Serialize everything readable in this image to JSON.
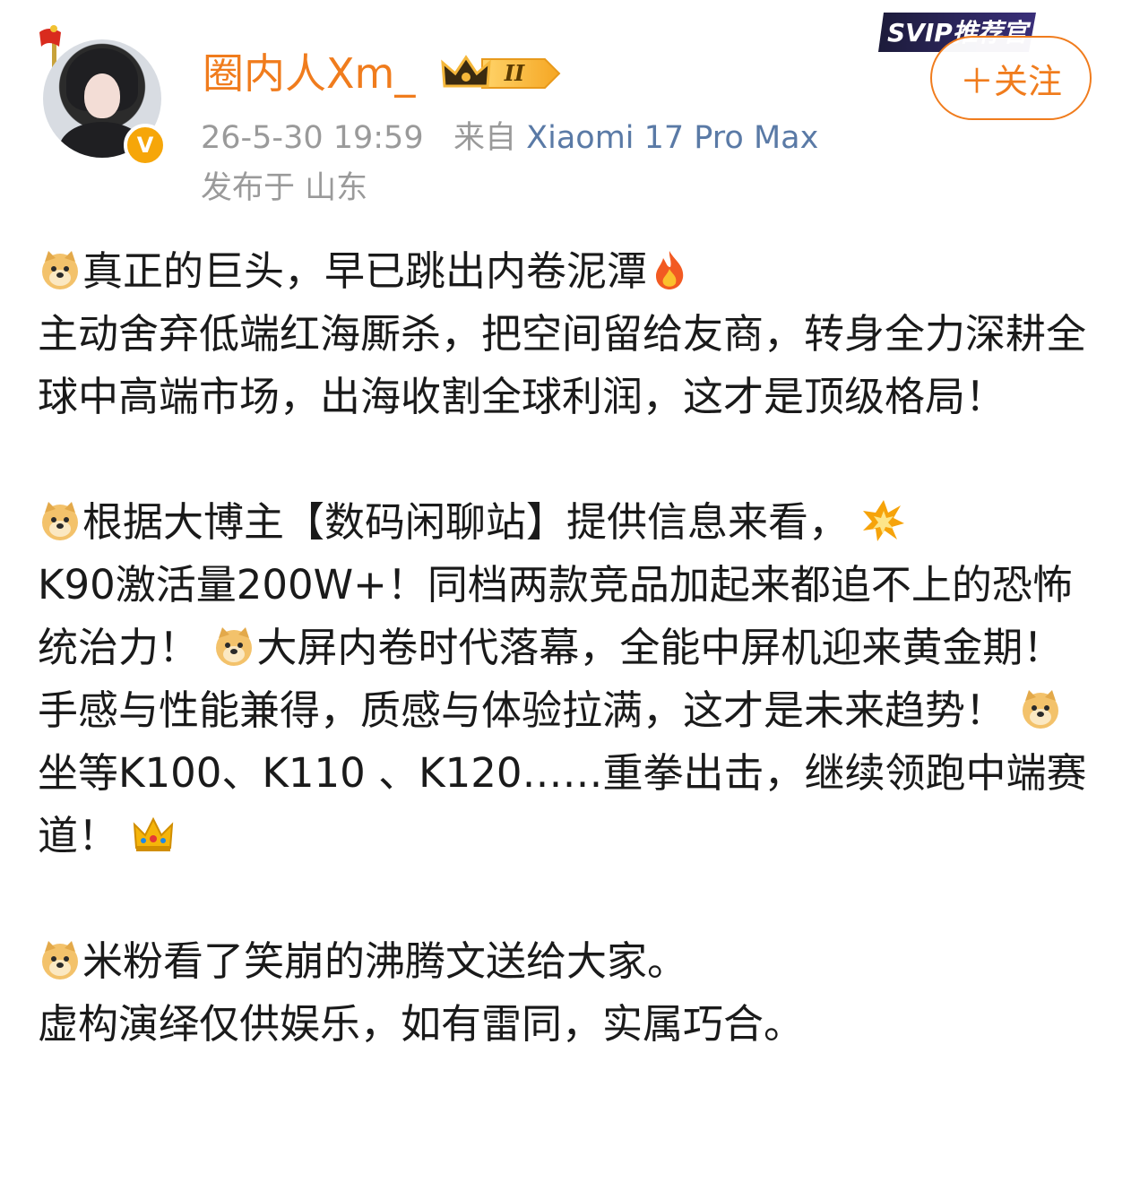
{
  "header": {
    "username": "圈内人Xm_",
    "level_badge": "II",
    "svip_label": "SVIP推荐官",
    "verified_mark": "V",
    "follow_label": "＋关注",
    "timestamp": "26-5-30 19:59",
    "source_prefix": "来自",
    "device": "Xiaomi 17 Pro Max",
    "location": "发布于 山东"
  },
  "post": {
    "p1": {
      "l1_a": "真正的巨头，早已跳出内卷泥潭",
      "l1_icon": "fire-emoji",
      "l2": "主动舍弃低端红海厮杀，把空间留给友商，转身全力深耕全球中高端市场，出海收割全球利润，这才是顶级格局！"
    },
    "p2": {
      "a": "根据大博主【数码闲聊站】提供信息来看，",
      "b": "K90激活量200W+！同档两款竞品加起来都追不上的恐怖统治力！",
      "c": "大屏内卷时代落幕，全能中屏机迎来黄金期！",
      "d": "手感与性能兼得，质感与体验拉满，这才是未来趋势！",
      "e": "坐等K100、K110 、K120……重拳出击，继续领跑中端赛道！"
    },
    "p3": {
      "a": "米粉看了笑崩的沸腾文送给大家。",
      "b": "虚构演绎仅供娱乐，如有雷同，实属巧合。"
    }
  },
  "colors": {
    "username": "#f07c1d",
    "meta_gray": "#9a9a9a",
    "device_blue": "#5a7aa6",
    "verified": "#f6a609"
  },
  "icons": [
    "doge-emoji",
    "fire-emoji",
    "explosion-emoji",
    "crown-emoji",
    "flag-icon",
    "verified-icon",
    "crown-level-badge"
  ]
}
